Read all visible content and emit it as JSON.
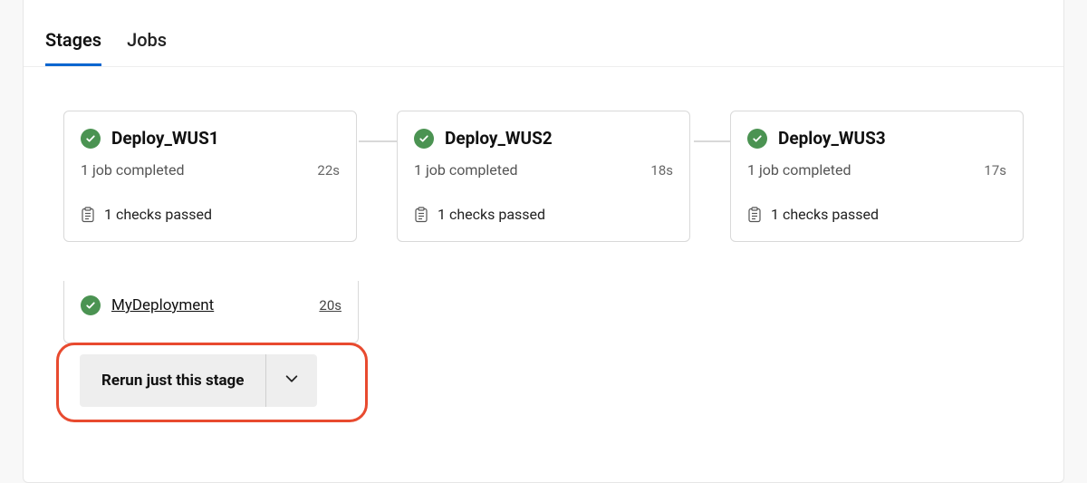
{
  "tabs": [
    {
      "label": "Stages",
      "active": true
    },
    {
      "label": "Jobs",
      "active": false
    }
  ],
  "stages": [
    {
      "name": "Deploy_WUS1",
      "status": "1 job completed",
      "duration": "22s",
      "checks": "1 checks passed",
      "expanded": {
        "job_name": "MyDeployment",
        "job_duration": "20s"
      }
    },
    {
      "name": "Deploy_WUS2",
      "status": "1 job completed",
      "duration": "18s",
      "checks": "1 checks passed"
    },
    {
      "name": "Deploy_WUS3",
      "status": "1 job completed",
      "duration": "17s",
      "checks": "1 checks passed"
    }
  ],
  "rerun": {
    "label": "Rerun just this stage"
  }
}
